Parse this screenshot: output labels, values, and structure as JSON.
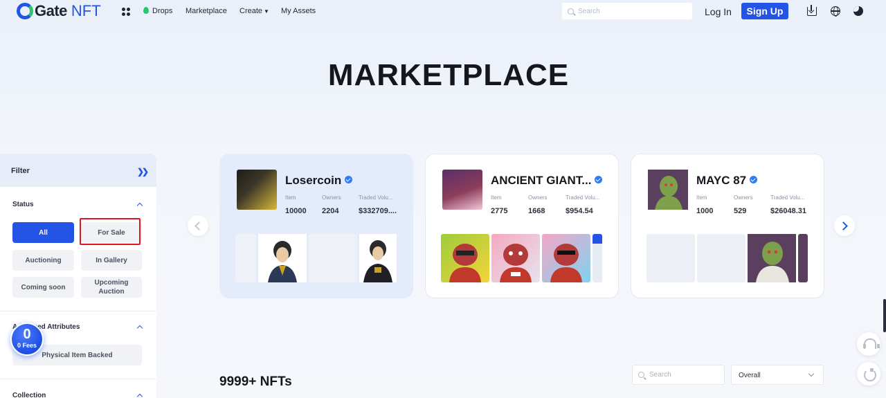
{
  "header": {
    "logo_text": "Gate",
    "logo_nft": "NFT",
    "nav": {
      "drops": "Drops",
      "marketplace": "Marketplace",
      "create": "Create",
      "my_assets": "My Assets"
    },
    "search_placeholder": "Search",
    "login": "Log In",
    "signup": "Sign Up",
    "icons": [
      "apps-icon",
      "drops-icon",
      "download-icon",
      "globe-icon",
      "theme-toggle-icon"
    ]
  },
  "hero": {
    "title": "MARKETPLACE"
  },
  "filter": {
    "title": "Filter",
    "status": {
      "title": "Status",
      "options": [
        "All",
        "For Sale",
        "Auctioning",
        "In Gallery",
        "Coming soon",
        "Upcoming Auction"
      ],
      "selected": "All"
    },
    "attributes": {
      "title": "Advanced Attributes",
      "options": [
        "Physical Item Backed"
      ]
    },
    "collection": {
      "title": "Collection"
    }
  },
  "fees_badge": {
    "value": "0",
    "label": "0 Fees"
  },
  "collections": [
    {
      "name": "Losercoin",
      "verified": true,
      "stats": [
        {
          "label": "Item",
          "value": "10000"
        },
        {
          "label": "Owners",
          "value": "2204"
        },
        {
          "label": "Traded Volu...",
          "value": "$332709...."
        }
      ]
    },
    {
      "name": "ANCIENT GIANT...",
      "verified": true,
      "stats": [
        {
          "label": "Item",
          "value": "2775"
        },
        {
          "label": "Owners",
          "value": "1668"
        },
        {
          "label": "Traded Volu...",
          "value": "$954.54"
        }
      ]
    },
    {
      "name": "MAYC 87",
      "verified": true,
      "stats": [
        {
          "label": "Item",
          "value": "1000"
        },
        {
          "label": "Owners",
          "value": "529"
        },
        {
          "label": "Traded Volu...",
          "value": "$26048.31"
        }
      ]
    }
  ],
  "listing": {
    "count": "9999+ NFTs",
    "search_placeholder": "Search",
    "sort": "Overall"
  },
  "colors": {
    "brand": "#2354e6",
    "accent_green": "#28c76f",
    "highlight_red": "#e0141e"
  }
}
